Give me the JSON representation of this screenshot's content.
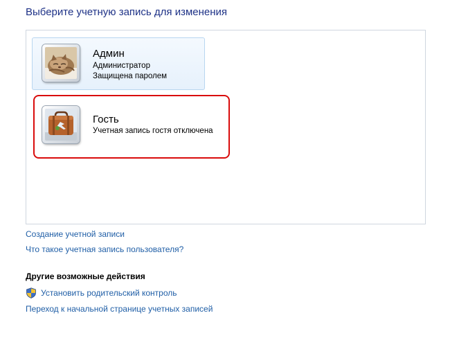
{
  "page": {
    "title": "Выберите учетную запись для изменения"
  },
  "accounts": [
    {
      "name": "Админ",
      "lines": [
        "Администратор",
        "Защищена паролем"
      ],
      "avatar": "kitten-avatar-icon"
    },
    {
      "name": "Гость",
      "lines": [
        "Учетная запись гостя отключена"
      ],
      "avatar": "suitcase-avatar-icon"
    }
  ],
  "links": {
    "create_account": "Создание учетной записи",
    "what_is_account": "Что такое учетная запись пользователя?"
  },
  "other_actions": {
    "heading": "Другие возможные действия",
    "parental_control": {
      "label": "Установить родительский контроль",
      "icon": "uac-shield-icon"
    },
    "home_link": "Переход к начальной странице учетных записей"
  },
  "colors": {
    "title": "#1e3287",
    "link": "#1f5ea6",
    "highlight_border": "#d90b0b",
    "hover_background": "#e6f1fc"
  }
}
